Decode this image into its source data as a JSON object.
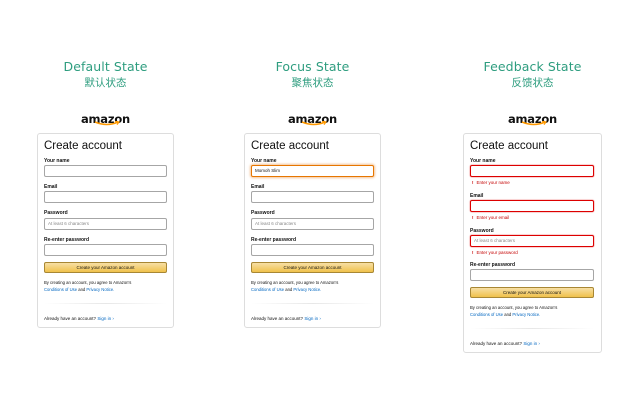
{
  "brand": {
    "logo_text": "amazon",
    "accent_color": "#2e9d7f",
    "error_color": "#c40000",
    "focus_color": "#e77600"
  },
  "states": [
    {
      "title": "Default State",
      "subtitle": "默认状态",
      "form": {
        "heading": "Create account",
        "name_label": "Your name",
        "name_value": "",
        "email_label": "Email",
        "email_value": "",
        "password_label": "Password",
        "password_placeholder": "At least 6 characters",
        "reenter_label": "Re-enter password",
        "reenter_value": "",
        "submit_label": "Create your Amazon account",
        "legal_prefix": "By creating an account, you agree to Amazon's",
        "conditions_link": "Conditions of Use",
        "legal_and": "and",
        "privacy_link": "Privacy Notice.",
        "signin_prompt": "Already have an account?",
        "signin_link": "Sign in ›"
      }
    },
    {
      "title": "Focus State",
      "subtitle": "聚焦状态",
      "form": {
        "heading": "Create account",
        "name_label": "Your name",
        "name_value": "Momoh Slim",
        "email_label": "Email",
        "email_value": "",
        "password_label": "Password",
        "password_placeholder": "At least 6 characters",
        "reenter_label": "Re-enter password",
        "reenter_value": "",
        "submit_label": "Create your Amazon account",
        "legal_prefix": "By creating an account, you agree to Amazon's",
        "conditions_link": "Conditions of Use",
        "legal_and": "and",
        "privacy_link": "Privacy Notice.",
        "signin_prompt": "Already have an account?",
        "signin_link": "Sign in ›"
      }
    },
    {
      "title": "Feedback State",
      "subtitle": "反馈状态",
      "form": {
        "heading": "Create account",
        "name_label": "Your name",
        "name_value": "",
        "name_error": "Enter your name",
        "email_label": "Email",
        "email_value": "",
        "email_error": "Enter your email",
        "password_label": "Password",
        "password_placeholder": "At least 6 characters",
        "password_error": "Enter your password",
        "reenter_label": "Re-enter password",
        "reenter_value": "",
        "submit_label": "Create your Amazon account",
        "legal_prefix": "By creating an account, you agree to Amazon's",
        "conditions_link": "Conditions of Use",
        "legal_and": "and",
        "privacy_link": "Privacy Notice.",
        "signin_prompt": "Already have an account?",
        "signin_link": "Sign in ›"
      }
    }
  ]
}
